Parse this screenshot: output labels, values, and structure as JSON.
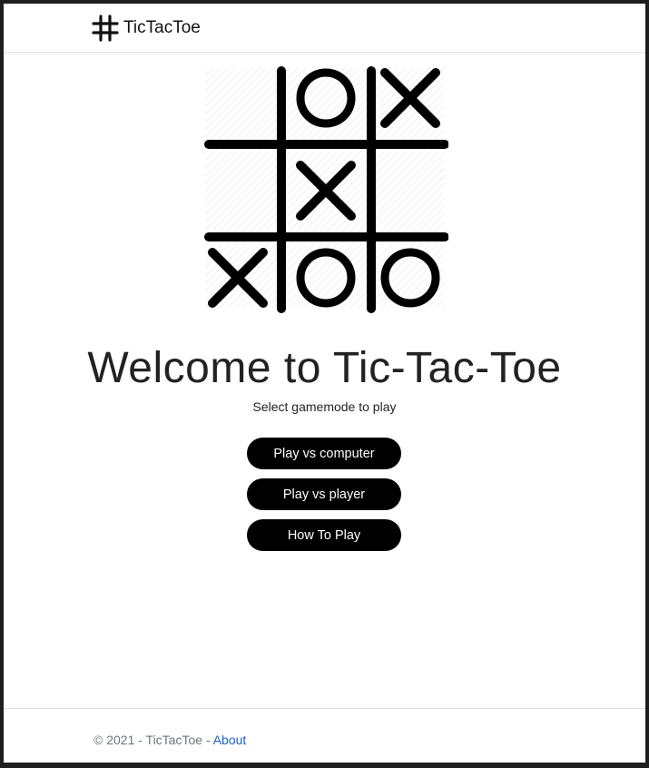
{
  "nav": {
    "brand_label": "TicTacToe",
    "brand_icon": "hash-icon"
  },
  "board": {
    "cells": [
      "",
      "O",
      "X",
      "",
      "X",
      "",
      "X",
      "O",
      "O"
    ]
  },
  "main": {
    "title": "Welcome to Tic-Tac-Toe",
    "subtitle": "Select gamemode to play",
    "buttons": {
      "vs_computer": "Play vs computer",
      "vs_player": "Play vs player",
      "how_to_play": "How To Play"
    }
  },
  "footer": {
    "copyright": "© 2021 - TicTacToe - ",
    "about_label": "About"
  },
  "colors": {
    "button_bg": "#000000",
    "link": "#1a62c7",
    "muted": "#6c757d"
  }
}
